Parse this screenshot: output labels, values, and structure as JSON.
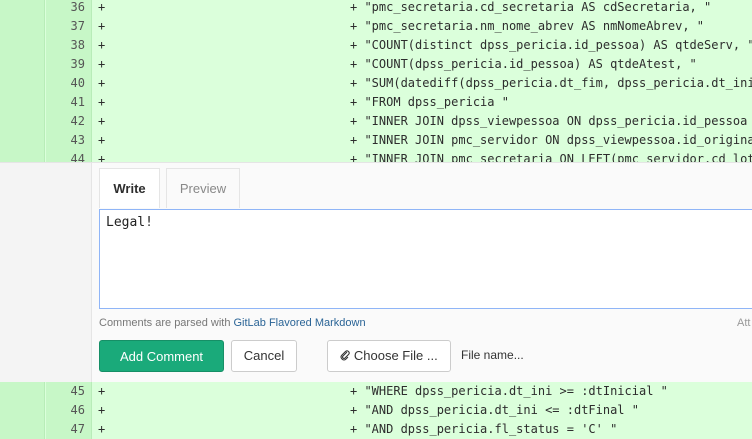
{
  "diff_top": [
    {
      "line": "36",
      "sign": "+",
      "code": "+ \"pmc_secretaria.cd_secretaria AS cdSecretaria, \""
    },
    {
      "line": "37",
      "sign": "+",
      "code": "+ \"pmc_secretaria.nm_nome_abrev AS nmNomeAbrev, \""
    },
    {
      "line": "38",
      "sign": "+",
      "code": "+ \"COUNT(distinct dpss_pericia.id_pessoa) AS qtdeServ, \""
    },
    {
      "line": "39",
      "sign": "+",
      "code": "+ \"COUNT(dpss_pericia.id_pessoa) AS qtdeAtest, \""
    },
    {
      "line": "40",
      "sign": "+",
      "code": "+ \"SUM(datediff(dpss_pericia.dt_fim, dpss_pericia.dt_ini"
    },
    {
      "line": "41",
      "sign": "+",
      "code": "+ \"FROM dpss_pericia \""
    },
    {
      "line": "42",
      "sign": "+",
      "code": "+ \"INNER JOIN dpss_viewpessoa ON dpss_pericia.id_pessoa"
    },
    {
      "line": "43",
      "sign": "+",
      "code": "+ \"INNER JOIN pmc_servidor ON dpss_viewpessoa.id_origina"
    },
    {
      "line": "44",
      "sign": "+",
      "code": "+ \"INNER JOIN pmc_secretaria ON LEFT(pmc_servidor.cd_lot"
    }
  ],
  "diff_bottom": [
    {
      "line": "45",
      "sign": "+",
      "code": "+ \"WHERE dpss_pericia.dt_ini >= :dtInicial \""
    },
    {
      "line": "46",
      "sign": "+",
      "code": "+ \"AND dpss_pericia.dt_ini <= :dtFinal \""
    },
    {
      "line": "47",
      "sign": "+",
      "code": "+ \"AND dpss_pericia.fl_status = 'C' \""
    }
  ],
  "tabs": {
    "write": "Write",
    "preview": "Preview"
  },
  "comment": {
    "text": "Legal!"
  },
  "hint": {
    "prefix": "Comments are parsed with ",
    "link": "GitLab Flavored Markdown",
    "right": "Att"
  },
  "buttons": {
    "add": "Add Comment",
    "cancel": "Cancel",
    "choose": "Choose File ...",
    "file_name": "File name..."
  },
  "icons": {
    "choose": "paperclip-icon"
  },
  "colors": {
    "added_bg": "#dbffdb",
    "gutter_bg": "#c7f7c7",
    "accent": "#1aaa7a"
  }
}
